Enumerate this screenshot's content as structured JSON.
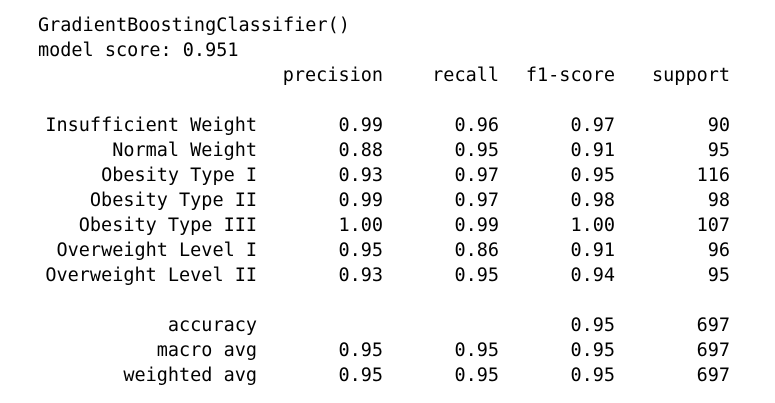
{
  "model_repr": "GradientBoostingClassifier()",
  "score_line": "model score: 0.951",
  "report": {
    "headers": {
      "precision": "precision",
      "recall": "recall",
      "f1": "f1-score",
      "support": "support"
    },
    "classes": [
      {
        "label": "Insufficient Weight",
        "precision": "0.99",
        "recall": "0.96",
        "f1": "0.97",
        "support": "90"
      },
      {
        "label": "Normal Weight",
        "precision": "0.88",
        "recall": "0.95",
        "f1": "0.91",
        "support": "95"
      },
      {
        "label": "Obesity Type I",
        "precision": "0.93",
        "recall": "0.97",
        "f1": "0.95",
        "support": "116"
      },
      {
        "label": "Obesity Type II",
        "precision": "0.99",
        "recall": "0.97",
        "f1": "0.98",
        "support": "98"
      },
      {
        "label": "Obesity Type III",
        "precision": "1.00",
        "recall": "0.99",
        "f1": "1.00",
        "support": "107"
      },
      {
        "label": "Overweight Level I",
        "precision": "0.95",
        "recall": "0.86",
        "f1": "0.91",
        "support": "96"
      },
      {
        "label": "Overweight Level II",
        "precision": "0.93",
        "recall": "0.95",
        "f1": "0.94",
        "support": "95"
      }
    ],
    "accuracy": {
      "label": "accuracy",
      "f1": "0.95",
      "support": "697"
    },
    "macro_avg": {
      "label": "macro avg",
      "precision": "0.95",
      "recall": "0.95",
      "f1": "0.95",
      "support": "697"
    },
    "weighted_avg": {
      "label": "weighted avg",
      "precision": "0.95",
      "recall": "0.95",
      "f1": "0.95",
      "support": "697"
    }
  }
}
